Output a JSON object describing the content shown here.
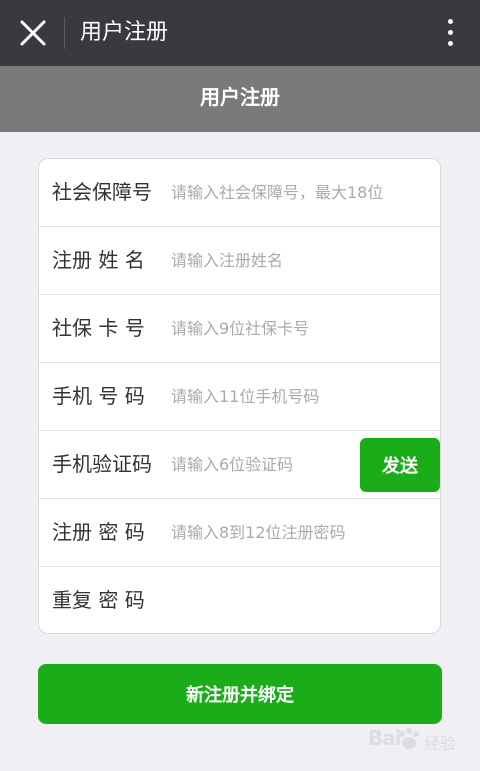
{
  "topbar": {
    "title": "用户注册"
  },
  "subheader": {
    "title": "用户注册"
  },
  "form": {
    "fields": [
      {
        "label": "社会保障号",
        "placeholder": "请输入社会保障号，最大18位"
      },
      {
        "label": "注册 姓 名",
        "placeholder": "请输入注册姓名"
      },
      {
        "label": "社保 卡 号",
        "placeholder": "请输入9位社保卡号"
      },
      {
        "label": "手机 号 码",
        "placeholder": "请输入11位手机号码"
      },
      {
        "label": "手机验证码",
        "placeholder": "请输入6位验证码"
      },
      {
        "label": "注册 密 码",
        "placeholder": "请输入8到12位注册密码"
      },
      {
        "label": "重复 密 码",
        "placeholder": ""
      }
    ],
    "send_button": "发送"
  },
  "submit_button": "新注册并绑定",
  "watermark": {
    "brand": "Bai",
    "brand_suffix": "经验"
  },
  "colors": {
    "topbar": "#393a3f",
    "subheader": "#7a7a7a",
    "accent_green": "#1aad19",
    "background": "#efeff4"
  },
  "icons": {
    "close": "close-icon",
    "more": "more-vertical-icon"
  }
}
